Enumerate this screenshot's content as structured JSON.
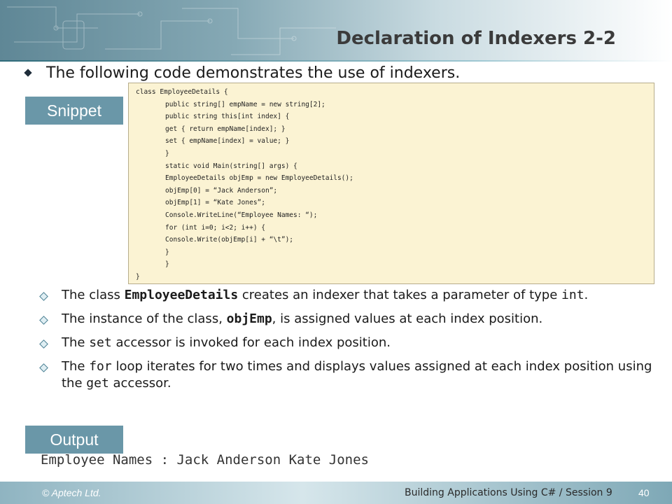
{
  "header": {
    "title": "Declaration of Indexers 2-2"
  },
  "intro": {
    "text": "The following code demonstrates the use of indexers."
  },
  "snippet_label": "Snippet",
  "code_lines": [
    {
      "text": "class EmployeeDetails {",
      "indent": 0
    },
    {
      "text": "public string[] empName = new string[2];",
      "indent": 1
    },
    {
      "text": "public string this[int index] {",
      "indent": 1
    },
    {
      "text": "get { return empName[index]; }",
      "indent": 1
    },
    {
      "text": "set { empName[index] = value; }",
      "indent": 1
    },
    {
      "text": "}",
      "indent": 1
    },
    {
      "text": "static void Main(string[] args) {",
      "indent": 1
    },
    {
      "text": "EmployeeDetails objEmp = new EmployeeDetails();",
      "indent": 1
    },
    {
      "text": "objEmp[0] = “Jack Anderson”;",
      "indent": 1
    },
    {
      "text": "objEmp[1] = “Kate Jones”;",
      "indent": 1
    },
    {
      "text": "Console.WriteLine(“Employee Names: “);",
      "indent": 1
    },
    {
      "text": "for (int i=0; i<2; i++) {",
      "indent": 1
    },
    {
      "text": "Console.Write(objEmp[i] + “\\t”);",
      "indent": 1
    },
    {
      "text": "}",
      "indent": 1
    },
    {
      "text": "}",
      "indent": 1
    },
    {
      "text": "}",
      "indent": 0
    }
  ],
  "bullets": [
    {
      "pre": "The class ",
      "code": "EmployeeDetails",
      "bold": true,
      "post": " creates an indexer that takes a parameter of type ",
      "code2": "int",
      "post2": "."
    },
    {
      "pre": "The instance of the class, ",
      "code": "objEmp",
      "bold": true,
      "post": ", is assigned values at each index position.",
      "code2": "",
      "post2": ""
    },
    {
      "pre": "The ",
      "code": "set",
      "bold": false,
      "post": " accessor is invoked for each index position.",
      "code2": "",
      "post2": ""
    },
    {
      "pre": "The ",
      "code": "for",
      "bold": false,
      "post": " loop  iterates for two times and displays values assigned at each index position using the ",
      "code2": "get",
      "post2": " accessor."
    }
  ],
  "output_label": "Output",
  "output_text": "Employee Names : Jack Anderson Kate Jones",
  "footer": {
    "copyright": "© Aptech Ltd.",
    "course": "Building Applications Using C# / Session 9",
    "page": "40"
  }
}
